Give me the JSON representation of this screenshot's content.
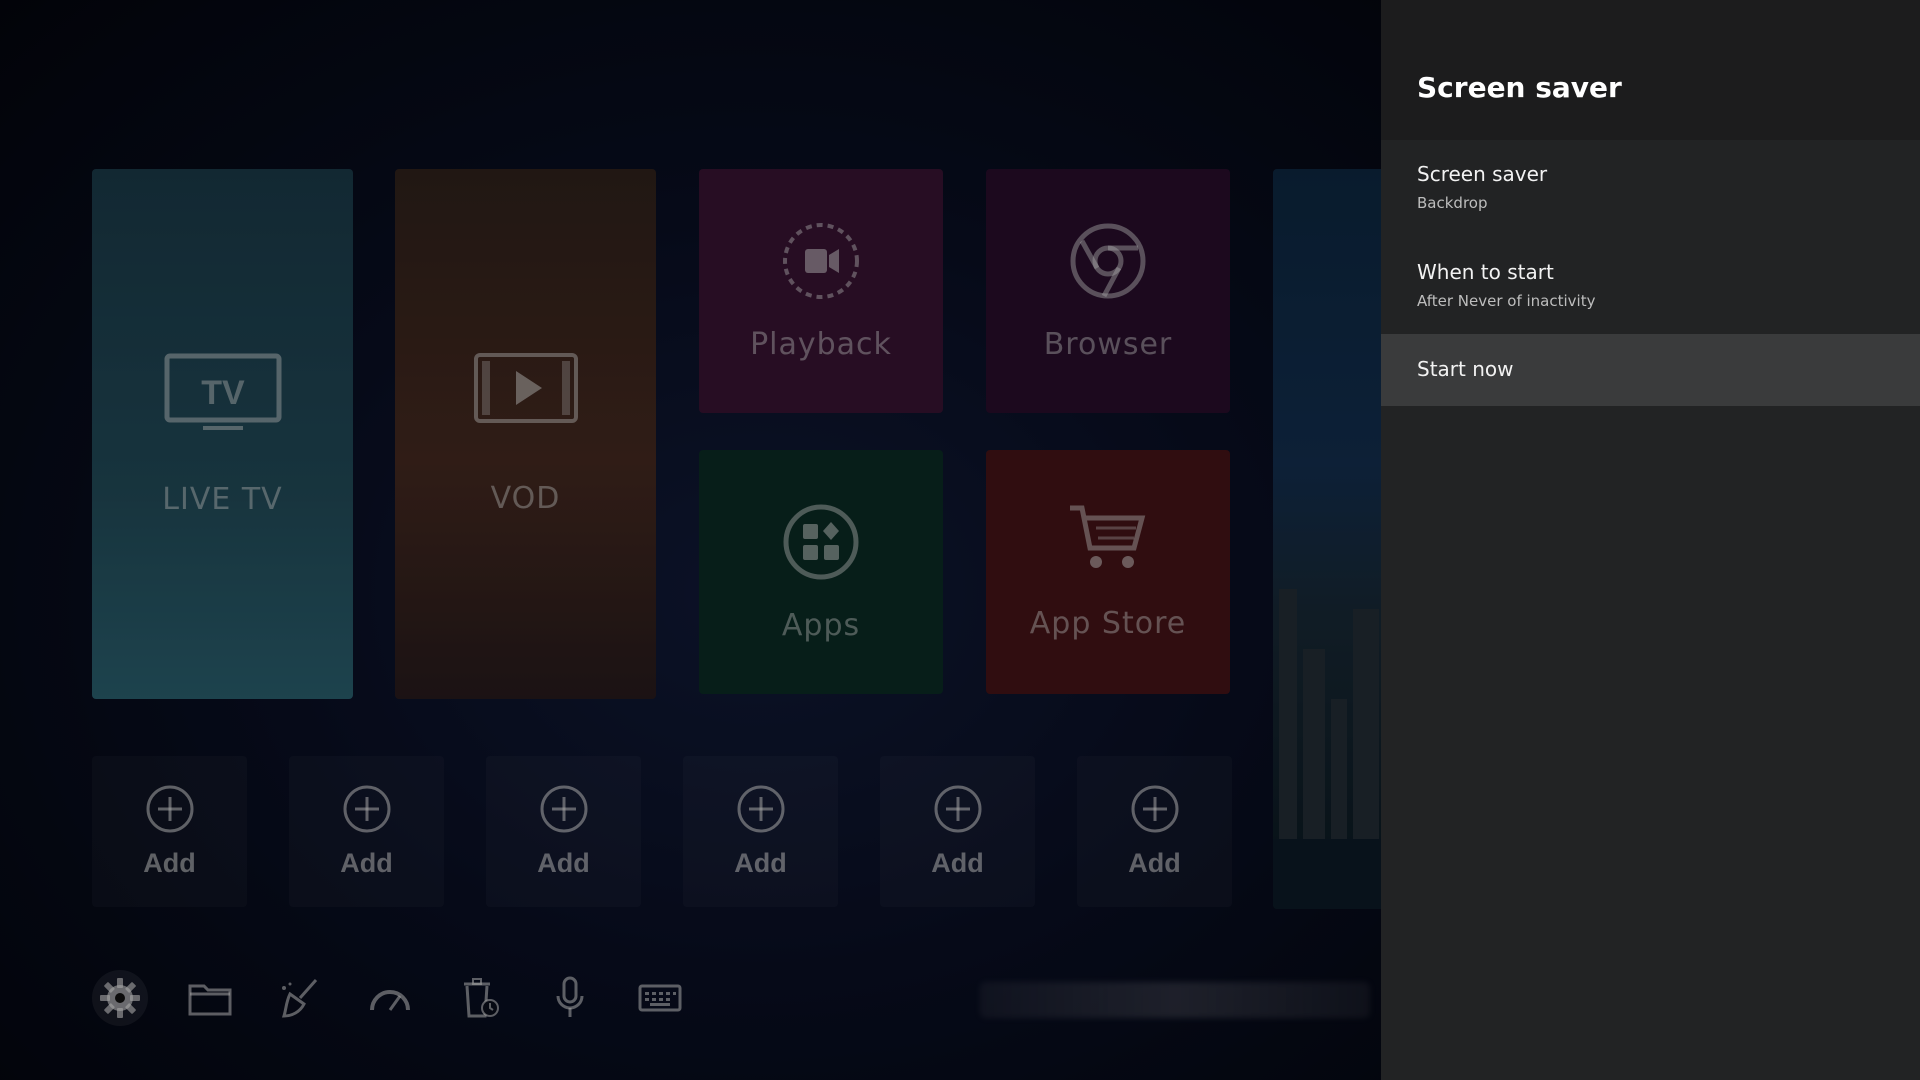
{
  "launcher": {
    "tiles": {
      "live_tv": "LIVE TV",
      "vod": "VOD",
      "playback": "Playback",
      "browser": "Browser",
      "apps": "Apps",
      "app_store": "App Store"
    },
    "add_slots": [
      "Add",
      "Add",
      "Add",
      "Add",
      "Add",
      "Add"
    ],
    "dock_icons": [
      "gear-icon",
      "folder-icon",
      "broom-icon",
      "speedometer-icon",
      "trash-clock-icon",
      "microphone-icon",
      "keyboard-icon"
    ]
  },
  "panel": {
    "title": "Screen saver",
    "items": [
      {
        "title": "Screen saver",
        "subtitle": "Backdrop"
      },
      {
        "title": "When to start",
        "subtitle": "After Never of inactivity"
      },
      {
        "title": "Start now",
        "subtitle": ""
      }
    ]
  },
  "colors": {
    "panel_bg": "#222324",
    "panel_header_bg": "#1c1c1d",
    "focus_row": "#3a3b3c"
  }
}
